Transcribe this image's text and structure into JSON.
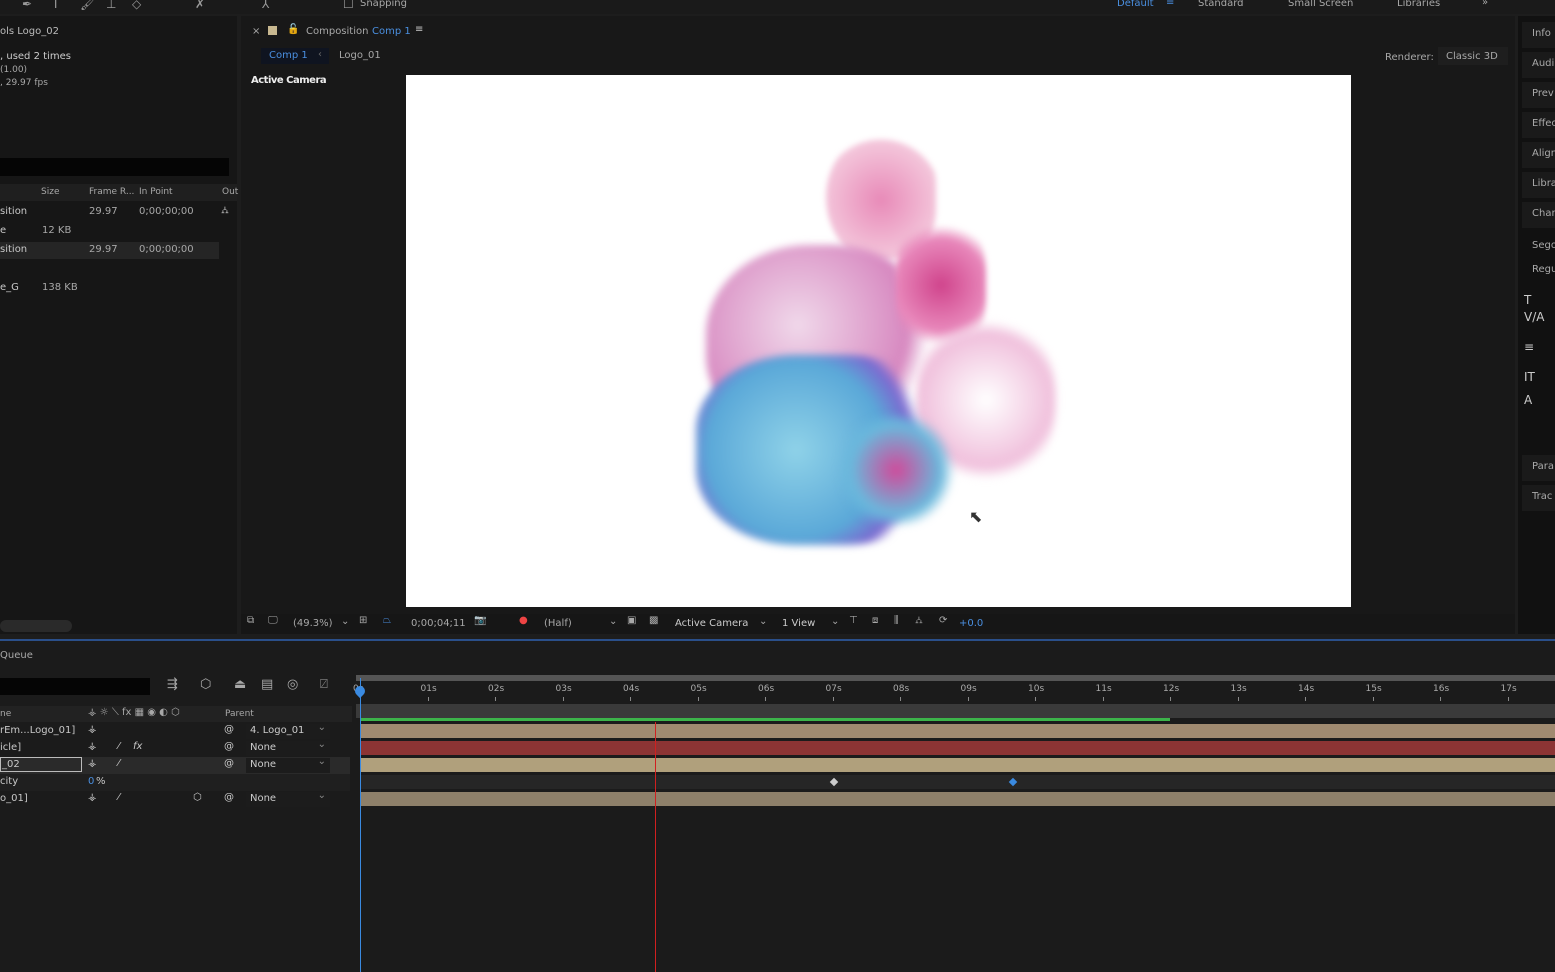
{
  "toolbar": {
    "snapping": "Snapping",
    "workspaces": [
      "Default",
      "Standard",
      "Small Screen",
      "Libraries"
    ],
    "active_workspace": "Default"
  },
  "project": {
    "title": "ols Logo_02",
    "info": [
      ", used 2 times",
      "(1.00)",
      ", 29.97 fps"
    ],
    "columns": [
      "Size",
      "Frame R...",
      "In Point",
      "Out"
    ],
    "rows": [
      {
        "name": "sition",
        "size": "",
        "fps": "29.97",
        "in": "0;00;00;00"
      },
      {
        "name": "e",
        "size": "12 KB",
        "fps": "",
        "in": ""
      },
      {
        "name": "sition",
        "size": "",
        "fps": "29.97",
        "in": "0;00;00;00"
      },
      {
        "name": "e_G",
        "size": "138 KB",
        "fps": "",
        "in": ""
      }
    ]
  },
  "composition": {
    "label": "Composition",
    "name": "Comp 1",
    "breadcrumbs": [
      "Comp 1",
      "Logo_01"
    ],
    "renderer_label": "Renderer:",
    "renderer": "Classic 3D",
    "view_label": "Active Camera"
  },
  "viewer_bar": {
    "zoom": "(49.3%)",
    "timecode": "0;00;04;11",
    "resolution": "(Half)",
    "camera": "Active Camera",
    "views": "1 View",
    "exposure": "+0.0"
  },
  "right_panel": [
    "Info",
    "Audi",
    "Prev",
    "Effec",
    "Align",
    "Libra",
    "Char",
    "Sego",
    "Regu",
    "Para",
    "Trac"
  ],
  "timeline": {
    "queue_label": "Queue",
    "name_col": "ne",
    "parent_col": "Parent",
    "ticks": [
      "0s",
      "01s",
      "02s",
      "03s",
      "04s",
      "05s",
      "06s",
      "07s",
      "08s",
      "09s",
      "10s",
      "11s",
      "12s",
      "13s",
      "14s",
      "15s",
      "16s",
      "17s"
    ],
    "current_time_s": 4.37,
    "layers": [
      {
        "name": "rEm...Logo_01]",
        "parent": "4. Logo_01",
        "color": "#a08a70"
      },
      {
        "name": "icle]",
        "parent": "None",
        "color": "#8c3434"
      },
      {
        "name": "_02",
        "parent": "None",
        "color": "#b0a07c"
      },
      {
        "name": "city",
        "value": "0",
        "unit": "%"
      },
      {
        "name": "o_01]",
        "parent": "None",
        "color": "#8e806a"
      }
    ]
  }
}
